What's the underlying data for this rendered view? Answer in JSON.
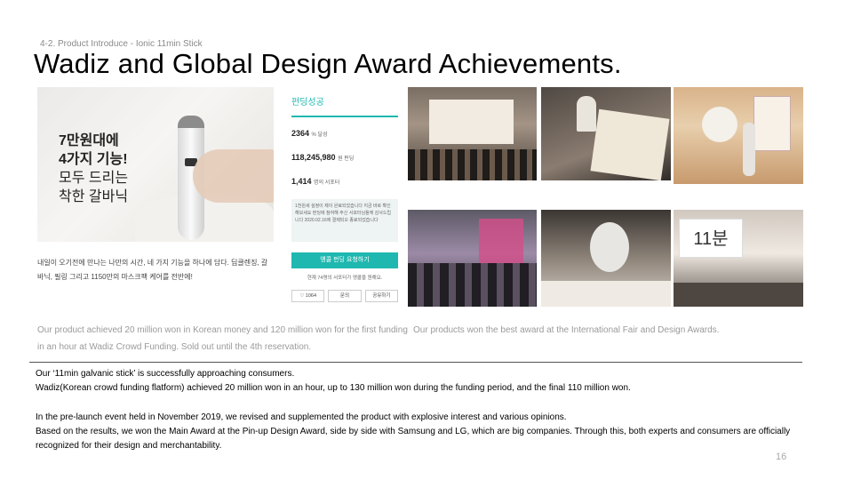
{
  "header": {
    "section_label": "4-2. Product Introduce - Ionic 11min Stick",
    "title": "Wadiz and Global Design Award Achievements."
  },
  "wadiz_screenshot": {
    "hero_text_bold": "7만원대에\n4가지 기능!",
    "hero_text_regular": "모두 드리는\n착한 갈바닉",
    "hero_description": "내일이 오기전에 만나는 나만의 시간, 네 가지 기능을 하나에 담다. 딥클렌징, 갈바닉, 필링 그리고 1150만의 마스크팩 케어를 전반에!",
    "funding_title": "펀딩성공",
    "stats": [
      {
        "value": "2364",
        "unit": "% 달성"
      },
      {
        "value": "118,245,980",
        "unit": "원 펀딩"
      },
      {
        "value": "1,414",
        "unit": "명의 서포터"
      }
    ],
    "notice": "1천원세 설정이 제이 완료되었습니다 지금 바로 확인해보세요 펀딩에 참여해 주신 서포터님들께 감사드립니다 2020.02.16에 결제되오 종료되었습니다",
    "fund_button": "앵콜 펀딩 요청하기",
    "fund_sub": "현재 74명의 서포터가 앵콜을 원해요.",
    "mini_buttons": [
      "♡ 1064",
      "문의",
      "공유하기"
    ]
  },
  "captions": {
    "wadiz": "Our product achieved 20 million won in Korean money and 120 million won for the first funding in an hour at Wadiz Crowd Funding. Sold out until the 4th reservation.",
    "awards": "Our products won the best award at the International Fair and Design Awards."
  },
  "photo_labels": {
    "logo": "11분"
  },
  "body": {
    "p1_line1": "Our ‘11min galvanic stick’ is successfully approaching consumers.",
    "p1_line2": "Wadiz(Korean crowd funding flatform) achieved 20 million won in an hour, up to 130 million won during the funding period, and the final 110 million won.",
    "p2_line1": "In the pre-launch event held in November 2019, we revised and supplemented the product with explosive interest and various opinions.",
    "p2_line2": "Based on the results, we won the Main Award at the Pin-up Design Award, side by side with Samsung and LG, which are big companies. Through this, both experts and consumers are officially recognized for their design and merchantability."
  },
  "page_number": "16"
}
